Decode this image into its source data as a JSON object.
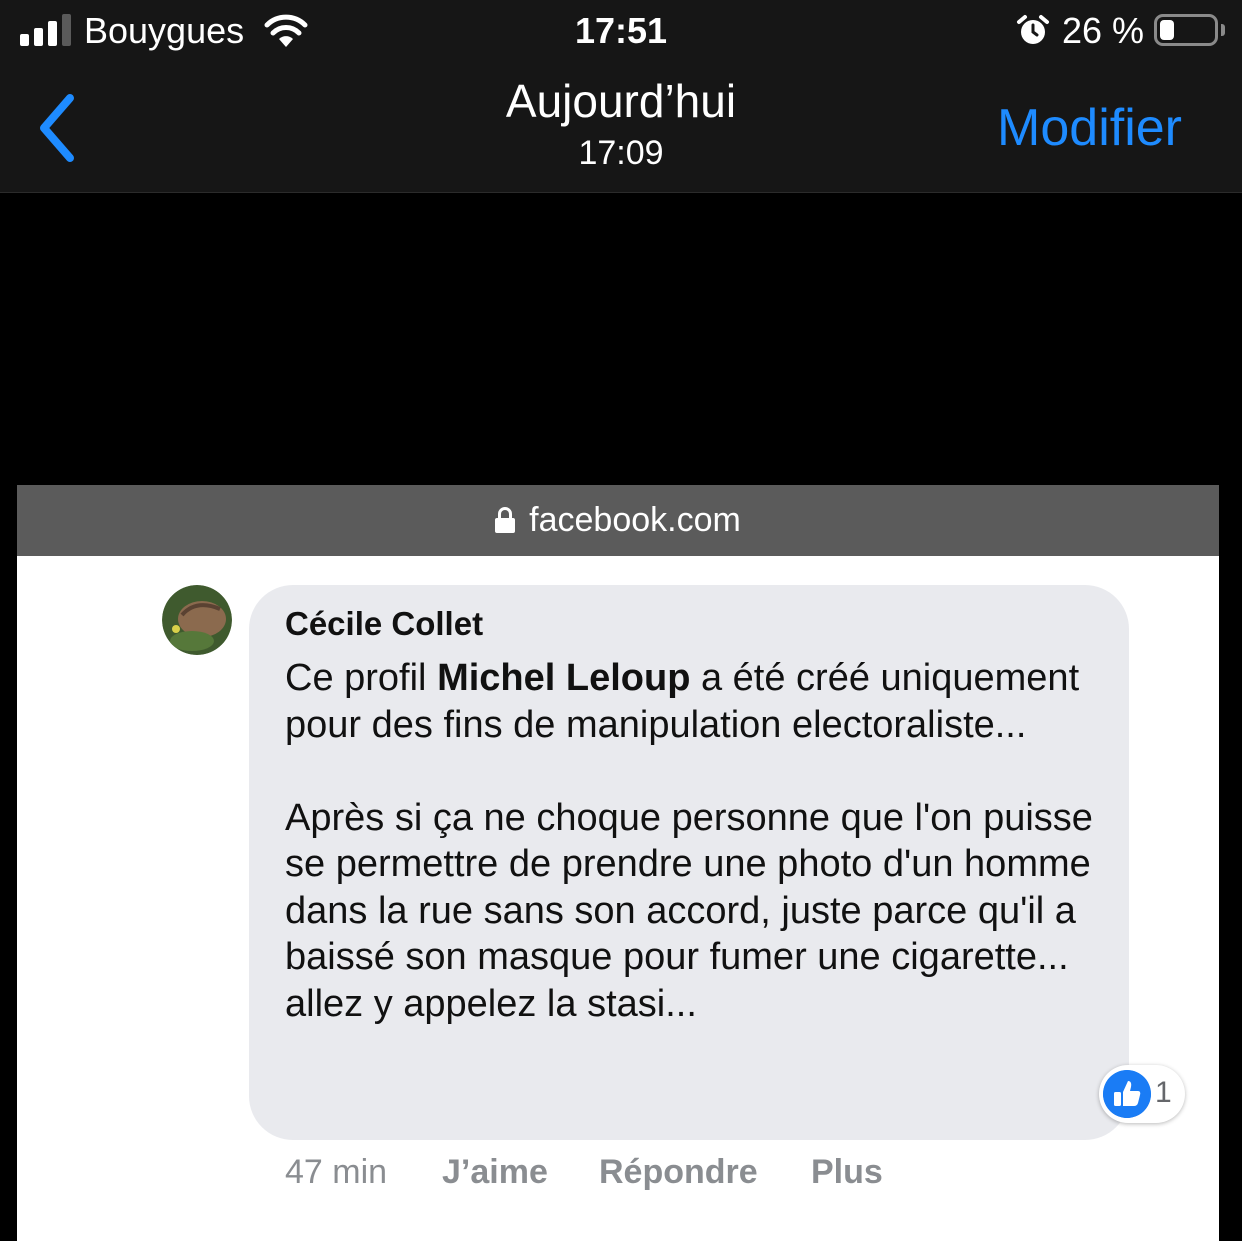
{
  "status_bar": {
    "carrier": "Bouygues",
    "time": "17:51",
    "battery_percent": "26 %",
    "battery_level": 0.26
  },
  "nav": {
    "title": "Aujourd’hui",
    "subtitle": "17:09",
    "edit_label": "Modifier",
    "accent": "#1e8bff"
  },
  "browser": {
    "url": "facebook.com"
  },
  "comment": {
    "author": "Cécile Collet",
    "text_before": "Ce profil ",
    "text_bold": "Michel Leloup",
    "text_after": " a été créé uniquement pour des fins de manipulation electoraliste...",
    "paragraph2": "Après si ça ne choque personne que l'on puisse se permettre de prendre une photo d'un homme dans la rue sans son accord, juste parce qu'il a baissé son masque pour fumer une cigarette... allez y appelez la stasi...",
    "reaction_count": "1",
    "time": "47 min",
    "like_label": "J’aime",
    "reply_label": "Répondre",
    "more_label": "Plus"
  }
}
